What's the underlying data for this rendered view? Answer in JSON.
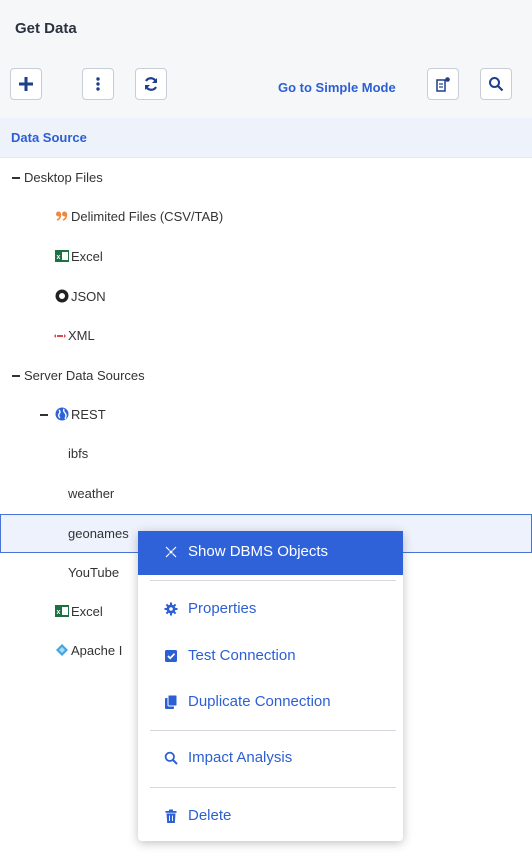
{
  "header": {
    "title": "Get Data"
  },
  "toolbar": {
    "add_icon": "plus-icon",
    "more_icon": "kebab-icon",
    "refresh_icon": "refresh-icon",
    "simple_mode_label": "Go to Simple Mode",
    "view_icon": "settings-view-icon",
    "search_icon": "search-icon"
  },
  "column": {
    "label": "Data Source"
  },
  "tree": {
    "desktop_files": "Desktop Files",
    "delimited": "Delimited Files (CSV/TAB)",
    "excel": "Excel",
    "json": "JSON",
    "xml": "XML",
    "server_sources": "Server Data Sources",
    "rest": "REST",
    "ibfs": "ibfs",
    "weather": "weather",
    "geonames": "geonames",
    "youtube": "YouTube",
    "excel2": "Excel",
    "apache": "Apache I"
  },
  "context_menu": {
    "show_dbms": "Show DBMS Objects",
    "properties": "Properties",
    "test_connection": "Test Connection",
    "duplicate_connection": "Duplicate Connection",
    "impact_analysis": "Impact Analysis",
    "delete": "Delete"
  },
  "colors": {
    "accent": "#2c5fd4",
    "menu_active": "#2f62d9",
    "header_bg": "#f6f7f9"
  }
}
